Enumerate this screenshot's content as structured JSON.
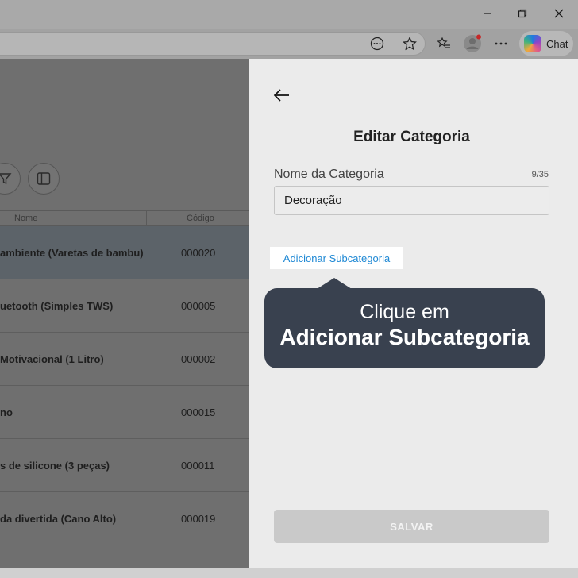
{
  "window": {
    "minimize_icon": "minimize-icon",
    "restore_icon": "restore-icon",
    "close_icon": "close-icon"
  },
  "toolbar": {
    "chat_label": "Chat"
  },
  "table": {
    "col_name": "Nome",
    "col_code": "Código",
    "rows": [
      {
        "name": "ambiente (Varetas de bambu)",
        "code": "000020",
        "selected": true
      },
      {
        "name": "uetooth (Simples TWS)",
        "code": "000005"
      },
      {
        "name": "Motivacional (1 Litro)",
        "code": "000002"
      },
      {
        "name": "no",
        "code": "000015"
      },
      {
        "name": "s de silicone (3 peças)",
        "code": "000011"
      },
      {
        "name": "da divertida (Cano Alto)",
        "code": "000019"
      }
    ]
  },
  "panel": {
    "title": "Editar Categoria",
    "field_label": "Nome da Categoria",
    "counter": "9/35",
    "field_value": "Decoração",
    "add_subcategory": "Adicionar Subcategoria",
    "save": "SALVAR"
  },
  "tooltip": {
    "line1": "Clique em",
    "line2": "Adicionar Subcategoria"
  }
}
